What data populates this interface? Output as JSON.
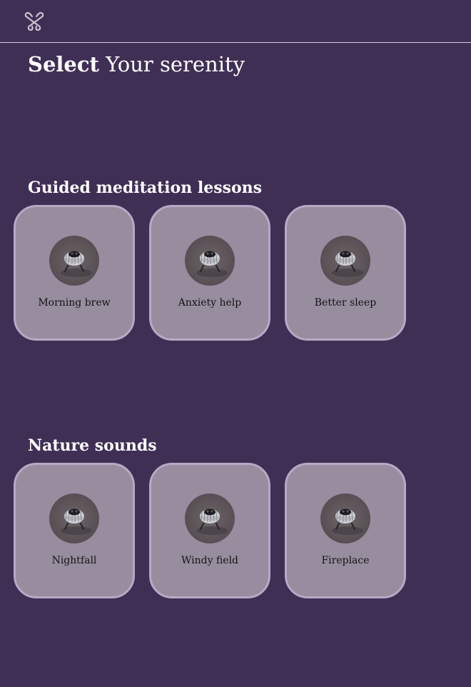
{
  "header": {
    "logo_icon": "knot-logo-icon"
  },
  "page": {
    "title_bold": "Select",
    "title_rest": " Your serenity"
  },
  "sections": [
    {
      "title": "Guided meditation lessons",
      "cards": [
        {
          "label": "Morning brew",
          "icon": "yarn-spool-image"
        },
        {
          "label": "Anxiety help",
          "icon": "yarn-spool-image"
        },
        {
          "label": "Better sleep",
          "icon": "yarn-spool-image"
        }
      ]
    },
    {
      "title": "Nature sounds",
      "cards": [
        {
          "label": "Nightfall",
          "icon": "yarn-spool-image"
        },
        {
          "label": "Windy field",
          "icon": "yarn-spool-image"
        },
        {
          "label": "Fireplace",
          "icon": "yarn-spool-image"
        }
      ]
    }
  ],
  "colors": {
    "background": "#402f55",
    "card": "#978d9f",
    "card_border": "#b6a9c6",
    "text_light": "#ffffff",
    "text_dark": "#141414"
  }
}
